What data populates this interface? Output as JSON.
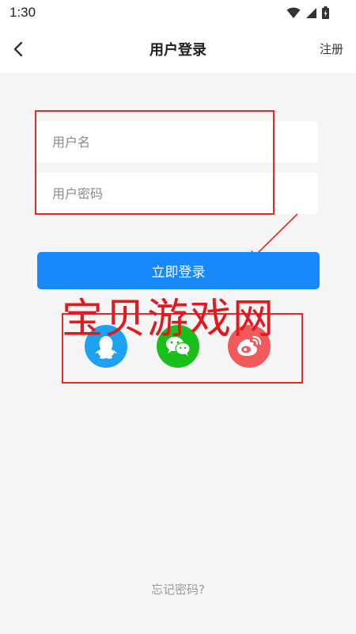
{
  "status_bar": {
    "time": "1:30"
  },
  "nav": {
    "back_icon": "chevron-left-icon",
    "title": "用户登录",
    "register": "注册"
  },
  "form": {
    "username_placeholder": "用户名",
    "password_placeholder": "用户密码",
    "login_label": "立即登录"
  },
  "watermark": "宝贝游戏网",
  "social": [
    {
      "icon": "qq-icon",
      "color": "#1da1f2"
    },
    {
      "icon": "wechat-icon",
      "color": "#1bbf1b"
    },
    {
      "icon": "weibo-icon",
      "color": "#f05a5a"
    }
  ],
  "forgot_password": "忘记密码?",
  "colors": {
    "accent": "#1789fb",
    "annotation_red": "#e32b2b",
    "background": "#f5f5f5"
  }
}
